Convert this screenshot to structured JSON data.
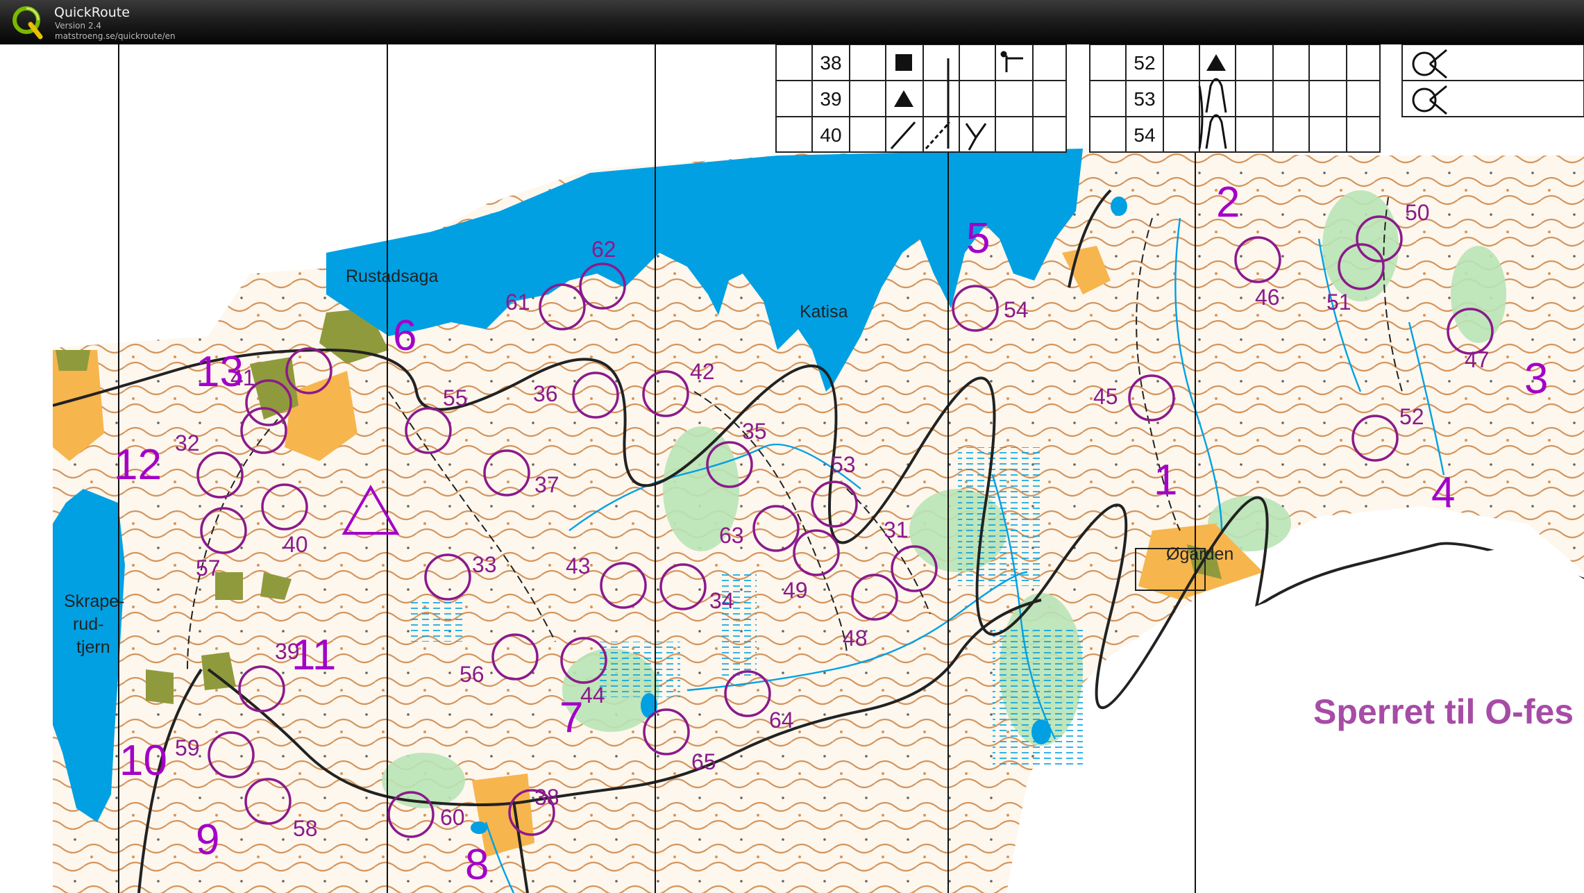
{
  "app": {
    "title": "QuickRoute",
    "version": "Version 2.4",
    "url": "matstroeng.se/quickroute/en"
  },
  "map": {
    "place_names": {
      "rustadsaga": "Rustadsaga",
      "katisa": "Katisa",
      "skrape": "Skrape-",
      "rud": "rud-",
      "tjern": "tjern",
      "ogarden": "Øgarden"
    },
    "restricted_text": "Sperret til O-fes",
    "control_description_rows_left": [
      "38",
      "39",
      "40"
    ],
    "control_description_rows_right": [
      "52",
      "53",
      "54"
    ],
    "course_numbers": {
      "n1": "1",
      "n2": "2",
      "n3": "3",
      "n4": "4",
      "n5": "5",
      "n6": "6",
      "n7": "7",
      "n8": "8",
      "n9": "9",
      "n10": "10",
      "n11": "11",
      "n12": "12",
      "n13": "13"
    },
    "control_codes": {
      "c31": "31",
      "c32": "32",
      "c33": "33",
      "c34": "34",
      "c35": "35",
      "c36": "36",
      "c37": "37",
      "c38": "38",
      "c39": "39",
      "c40": "40",
      "c41": "41",
      "c42": "42",
      "c43": "43",
      "c44": "44",
      "c45": "45",
      "c46": "46",
      "c47": "47",
      "c48": "48",
      "c49": "49",
      "c50": "50",
      "c51": "51",
      "c52": "52",
      "c53": "53",
      "c54": "54",
      "c55": "55",
      "c56": "56",
      "c57": "57",
      "c58": "58",
      "c59": "59",
      "c60": "60",
      "c61": "61",
      "c62": "62",
      "c63": "63",
      "c64": "64",
      "c65": "65"
    },
    "colors": {
      "water": "#00a0e3",
      "course": "#a300c8",
      "control_circle": "#8b1a8b",
      "rough_open": "#f7b54d",
      "forest_green": "#b9e3b6",
      "contour": "#c46b1e",
      "restricted": "#a64ca6"
    }
  }
}
